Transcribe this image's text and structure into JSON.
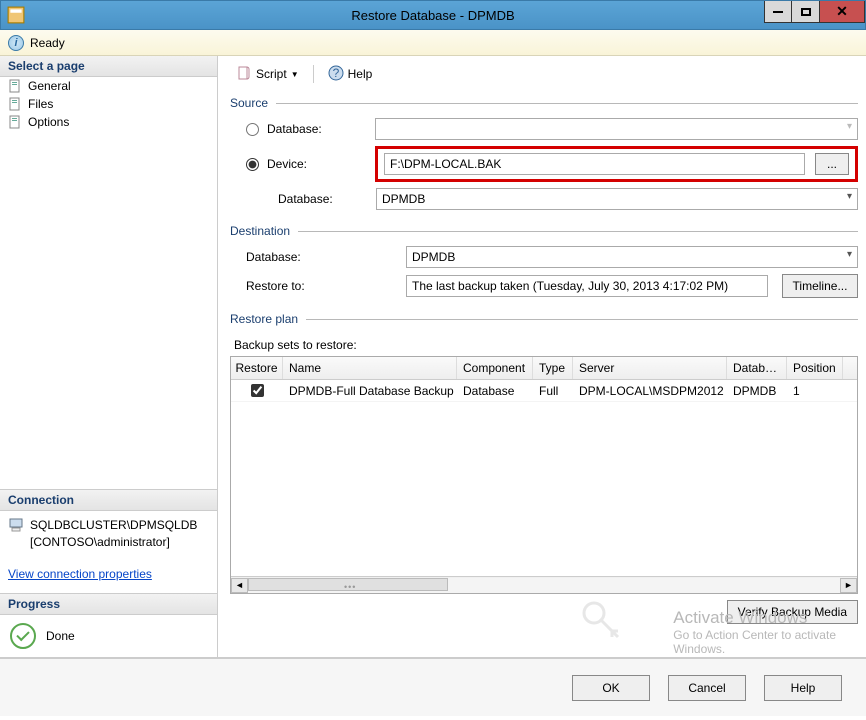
{
  "window": {
    "title": "Restore Database - DPMDB"
  },
  "readybar": {
    "text": "Ready"
  },
  "sidebar": {
    "select_page_header": "Select a page",
    "pages": [
      {
        "label": "General"
      },
      {
        "label": "Files"
      },
      {
        "label": "Options"
      }
    ],
    "connection_header": "Connection",
    "connection_server": "SQLDBCLUSTER\\DPMSQLDB",
    "connection_user": "[CONTOSO\\administrator]",
    "view_connection_link": "View connection properties",
    "progress_header": "Progress",
    "progress_status": "Done"
  },
  "toolbar": {
    "script": "Script",
    "help": "Help"
  },
  "source": {
    "group": "Source",
    "database_radio": "Database:",
    "device_radio": "Device:",
    "device_path": "F:\\DPM-LOCAL.BAK",
    "browse": "...",
    "database_label": "Database:",
    "database_value": "DPMDB"
  },
  "destination": {
    "group": "Destination",
    "database_label": "Database:",
    "database_value": "DPMDB",
    "restore_to_label": "Restore to:",
    "restore_to_value": "The last backup taken (Tuesday, July 30, 2013 4:17:02 PM)",
    "timeline": "Timeline..."
  },
  "restore_plan": {
    "group": "Restore plan",
    "subhead": "Backup sets to restore:",
    "columns": {
      "restore": "Restore",
      "name": "Name",
      "component": "Component",
      "type": "Type",
      "server": "Server",
      "database": "Database",
      "position": "Position"
    },
    "rows": [
      {
        "restore": true,
        "name": "DPMDB-Full Database Backup",
        "component": "Database",
        "type": "Full",
        "server": "DPM-LOCAL\\MSDPM2012",
        "database": "DPMDB",
        "position": "1"
      }
    ],
    "verify": "Verify Backup Media"
  },
  "watermark": {
    "line1": "Activate Windows",
    "line2": "Go to Action Center to activate",
    "line3": "Windows."
  },
  "buttons": {
    "ok": "OK",
    "cancel": "Cancel",
    "help": "Help"
  }
}
